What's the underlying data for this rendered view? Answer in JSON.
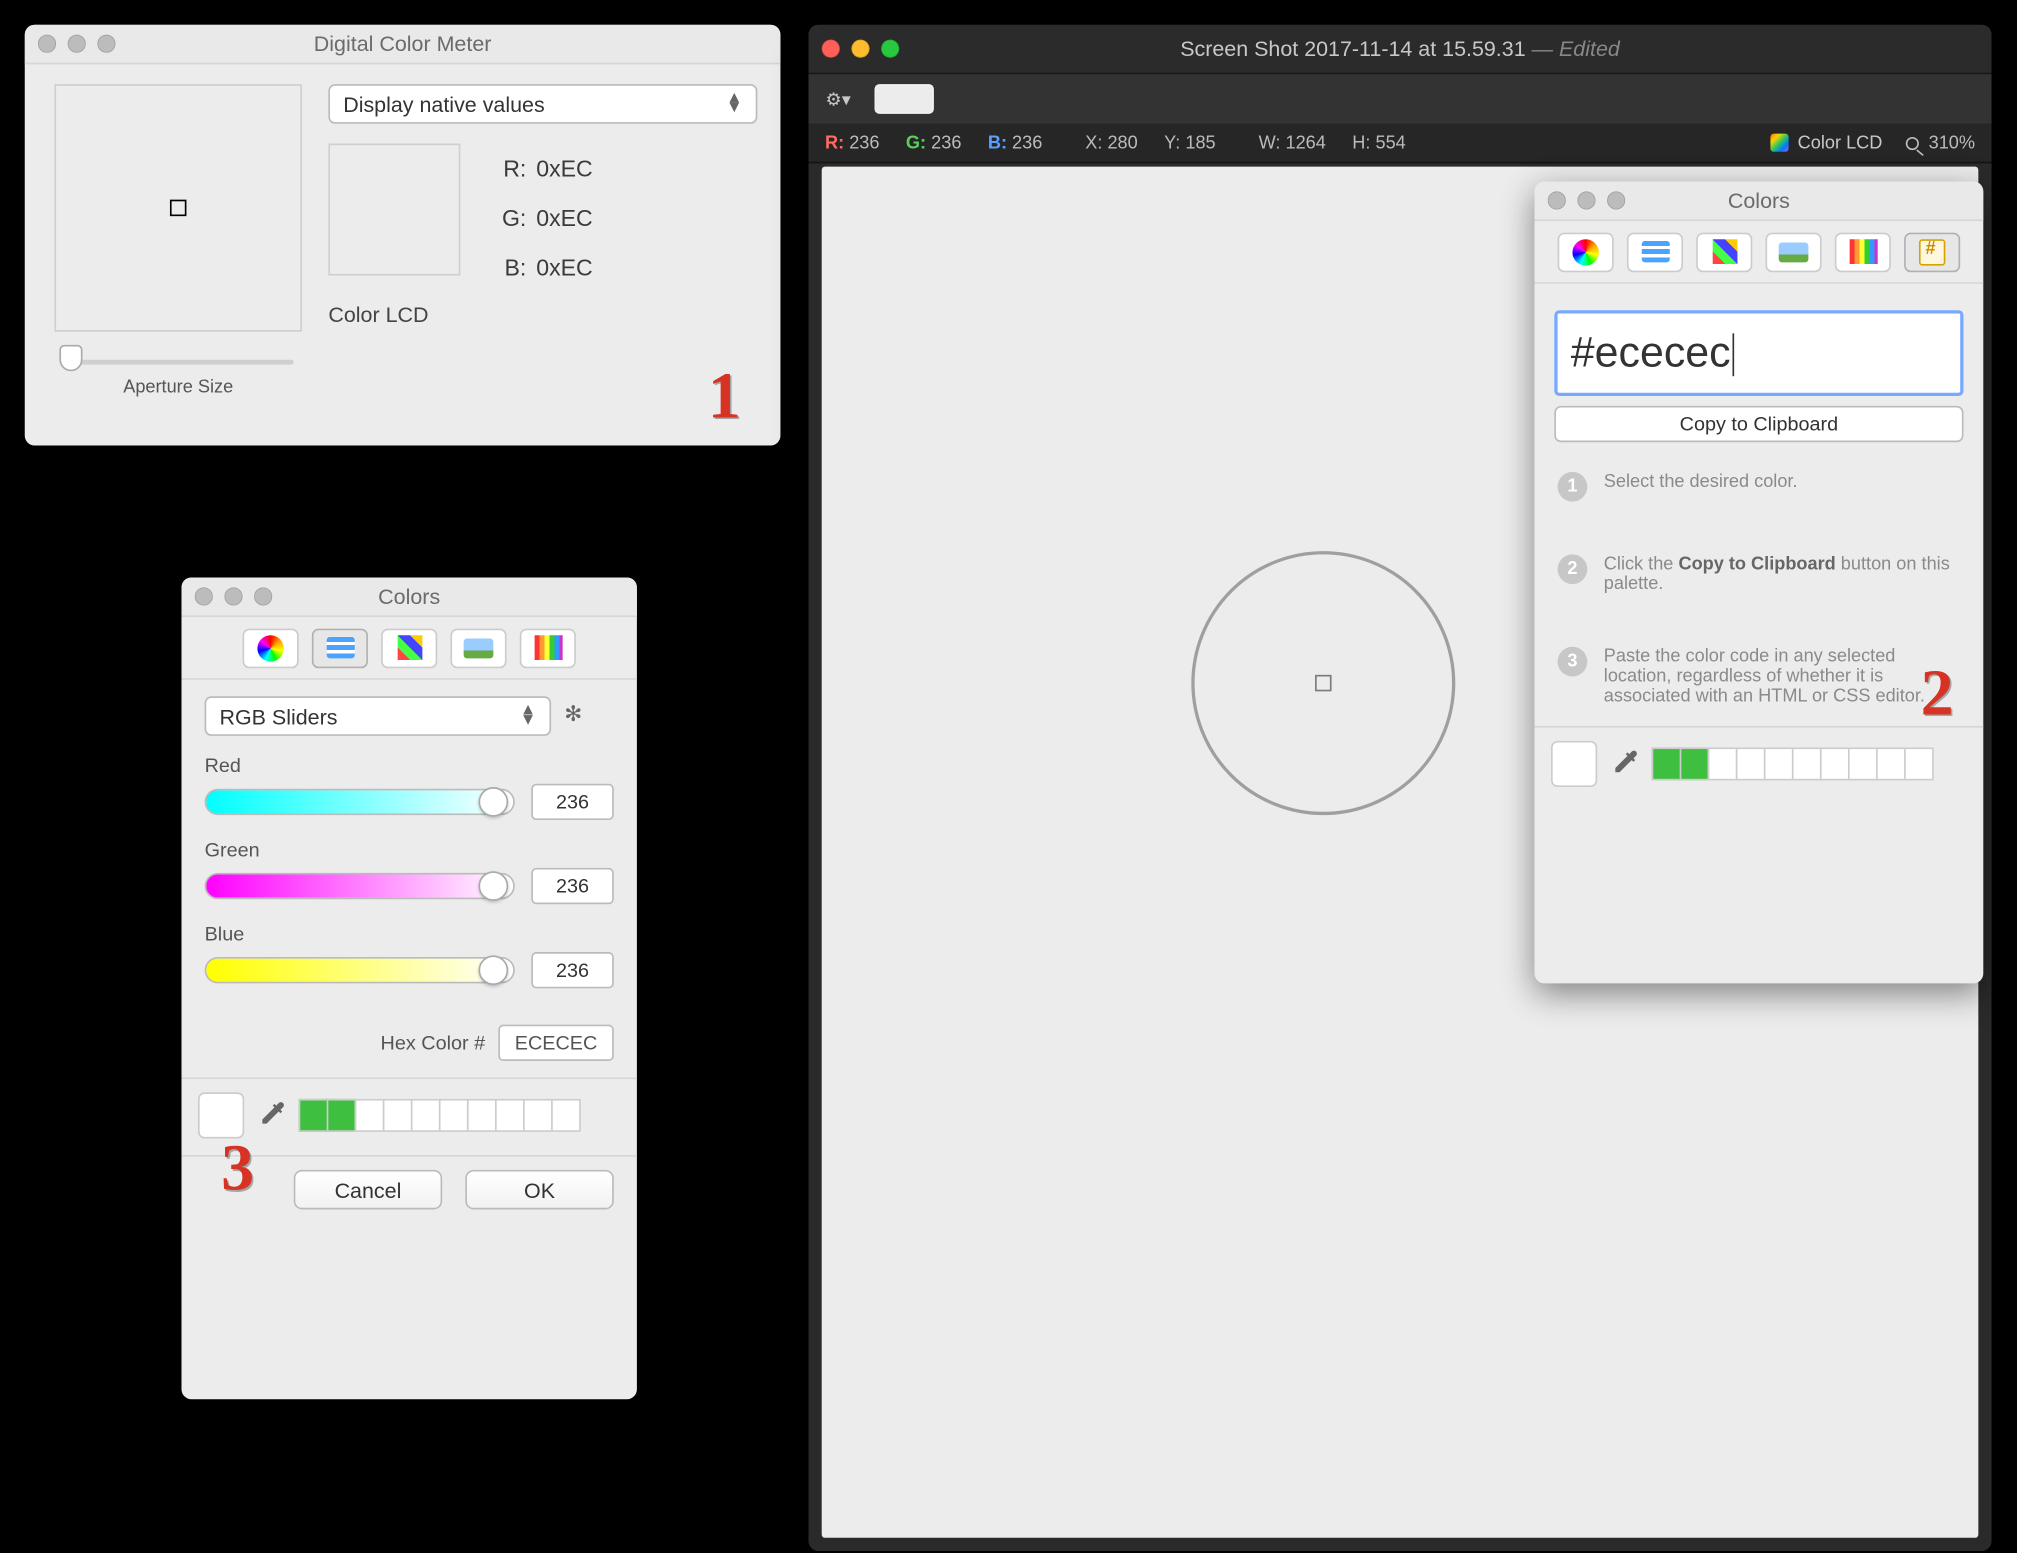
{
  "dcm": {
    "title": "Digital Color Meter",
    "mode": "Display native values",
    "rgb": {
      "r_label": "R:",
      "r": "0xEC",
      "g_label": "G:",
      "g": "0xEC",
      "b_label": "B:",
      "b": "0xEC"
    },
    "profile": "Color LCD",
    "aperture_label": "Aperture Size",
    "annotation": "1"
  },
  "preview": {
    "title_main": "Screen Shot 2017-11-14 at 15.59.31",
    "title_suffix": " — Edited",
    "info": {
      "r_label": "R:",
      "r": "236",
      "g_label": "G:",
      "g": "236",
      "b_label": "B:",
      "b": "236",
      "x_label": "X:",
      "x": "280",
      "y_label": "Y:",
      "y": "185",
      "w_label": "W:",
      "w": "1264",
      "h_label": "H:",
      "h": "554",
      "profile": "Color LCD",
      "zoom": "310%"
    }
  },
  "colors2": {
    "title": "Colors",
    "hex_value": "#ececec",
    "copy_label": "Copy to Clipboard",
    "step1": "Select the desired color.",
    "step2_pre": "Click the ",
    "step2_bold": "Copy to Clipboard",
    "step2_post": " button on this palette.",
    "step3": "Paste the color code in any selected location, regardless of whether it is associated with an HTML or CSS editor.",
    "annotation": "2"
  },
  "colors3": {
    "title": "Colors",
    "mode": "RGB Sliders",
    "red_label": "Red",
    "red_value": "236",
    "green_label": "Green",
    "green_value": "236",
    "blue_label": "Blue",
    "blue_value": "236",
    "hex_label": "Hex Color #",
    "hex_value": "ECECEC",
    "cancel": "Cancel",
    "ok": "OK",
    "annotation": "3"
  }
}
